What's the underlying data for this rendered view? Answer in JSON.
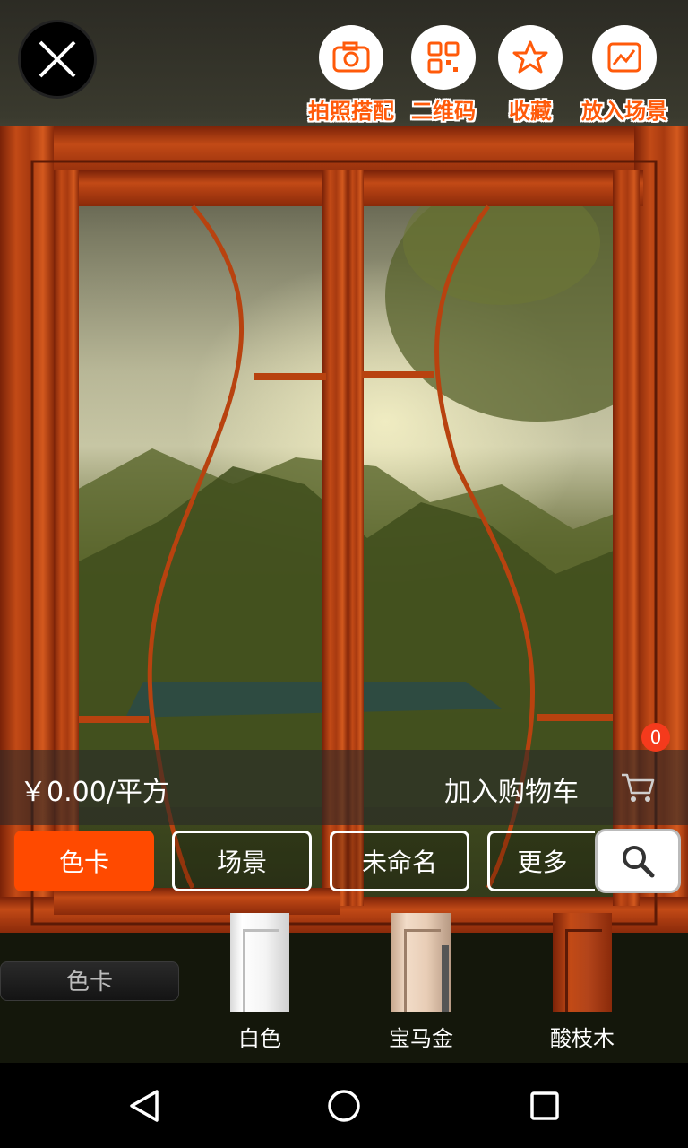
{
  "top_actions": [
    {
      "label": "拍照搭配",
      "icon": "camera-icon"
    },
    {
      "label": "二维码",
      "icon": "qr-code-icon"
    },
    {
      "label": "收藏",
      "icon": "star-icon"
    },
    {
      "label": "放入场景",
      "icon": "scene-image-icon"
    }
  ],
  "price_bar": {
    "price": "￥0.00/平方",
    "add_to_cart": "加入购物车",
    "cart_count": "0"
  },
  "tabs": [
    {
      "label": "色卡",
      "active": true
    },
    {
      "label": "场景",
      "active": false
    },
    {
      "label": "未命名",
      "active": false
    },
    {
      "label": "更多",
      "active": false
    }
  ],
  "category_label": "色卡",
  "swatches": [
    {
      "name": "白色",
      "color": "#ffffff"
    },
    {
      "name": "宝马金",
      "color": "#e8cdb6"
    },
    {
      "name": "酸枝木",
      "color": "#b2441a"
    }
  ],
  "colors": {
    "accent": "#ff4a00",
    "frame_wood": "#a83a10",
    "badge": "#f53a1c"
  }
}
